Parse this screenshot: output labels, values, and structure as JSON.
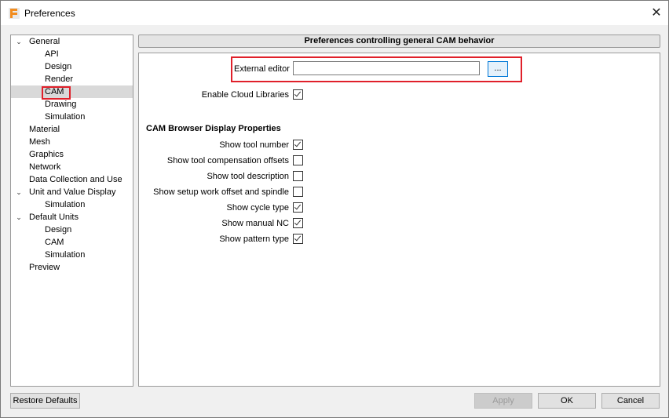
{
  "window": {
    "title": "Preferences"
  },
  "tree": {
    "items": [
      {
        "label": "General",
        "expanded": true
      },
      {
        "label": "API"
      },
      {
        "label": "Design"
      },
      {
        "label": "Render"
      },
      {
        "label": "CAM",
        "selected": true
      },
      {
        "label": "Drawing"
      },
      {
        "label": "Simulation"
      },
      {
        "label": "Material"
      },
      {
        "label": "Mesh"
      },
      {
        "label": "Graphics"
      },
      {
        "label": "Network"
      },
      {
        "label": "Data Collection and Use"
      },
      {
        "label": "Unit and Value Display",
        "expanded": true
      },
      {
        "label": "Simulation"
      },
      {
        "label": "Default Units",
        "expanded": true
      },
      {
        "label": "Design"
      },
      {
        "label": "CAM"
      },
      {
        "label": "Simulation"
      },
      {
        "label": "Preview"
      }
    ]
  },
  "main": {
    "header": "Preferences controlling general CAM behavior",
    "external_editor": {
      "label": "External editor",
      "value": "",
      "browse_label": "..."
    },
    "cloud_libraries": {
      "label": "Enable Cloud Libraries",
      "checked": true
    },
    "browser_section": {
      "title": "CAM Browser Display Properties",
      "options": [
        {
          "label": "Show tool number",
          "checked": true
        },
        {
          "label": "Show tool compensation offsets",
          "checked": false
        },
        {
          "label": "Show tool description",
          "checked": false
        },
        {
          "label": "Show setup work offset and spindle",
          "checked": false
        },
        {
          "label": "Show cycle type",
          "checked": true
        },
        {
          "label": "Show manual NC",
          "checked": true
        },
        {
          "label": "Show pattern type",
          "checked": true
        }
      ]
    }
  },
  "footer": {
    "restore_label": "Restore Defaults",
    "apply_label": "Apply",
    "ok_label": "OK",
    "cancel_label": "Cancel"
  },
  "colors": {
    "highlight": "#e0202a",
    "accent": "#0078d7",
    "brand": "#f28c1e"
  }
}
